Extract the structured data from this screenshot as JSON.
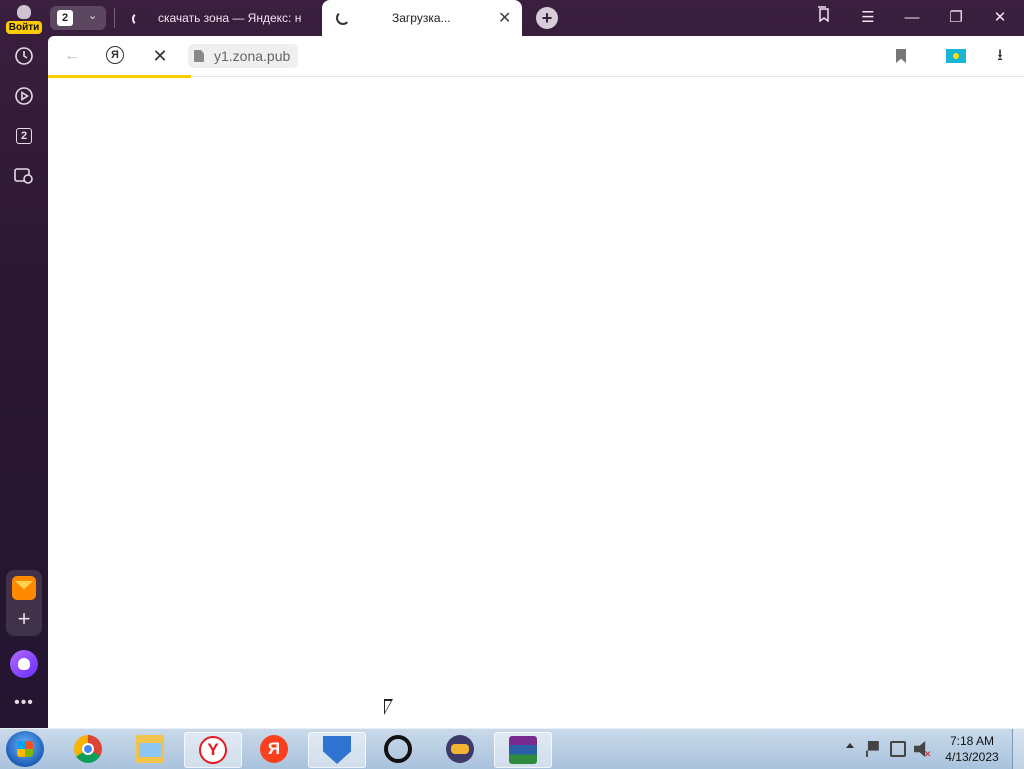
{
  "sidebar": {
    "login_label": "Войти",
    "tabs_count": "2"
  },
  "tabstrip": {
    "tab_count": "2",
    "tabs": [
      {
        "title": "скачать зона — Яндекс: н",
        "loading": true,
        "active": false
      },
      {
        "title": "Загрузка...",
        "loading": true,
        "active": true
      }
    ]
  },
  "toolbar": {
    "address": "y1.zona.pub",
    "yandex_button": "Я"
  },
  "colors": {
    "progress": "#ffcc00",
    "sidebar_bg": "#2a1730"
  },
  "taskbar": {
    "apps": [
      "chrome",
      "explorer",
      "yandex-browser",
      "yandex",
      "shield-app",
      "ring-app",
      "gamepad-app",
      "winrar"
    ],
    "yandex_browser_letter": "Y",
    "yandex_letter": "Я",
    "time": "7:18 AM",
    "date": "4/13/2023"
  }
}
